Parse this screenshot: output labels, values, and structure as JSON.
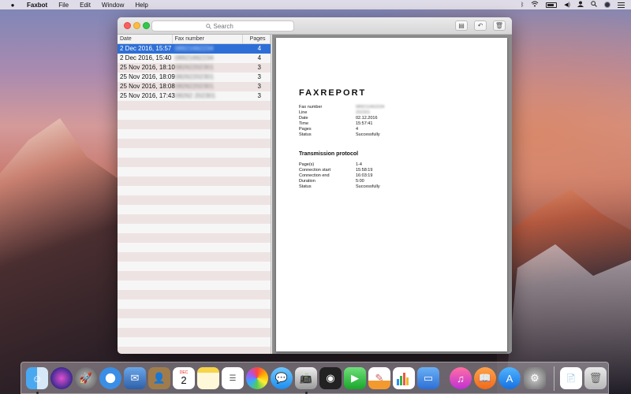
{
  "menubar": {
    "apple": "",
    "app": "Faxbot",
    "items": [
      "File",
      "Edit",
      "Window",
      "Help"
    ],
    "status": {
      "bluetooth": "ᛒ",
      "volume": "◀)",
      "battery_icon": "battery-icon",
      "list_icon": "list-icon",
      "user": "👤",
      "search": "🔍",
      "wifi": "wifi"
    }
  },
  "window": {
    "search_placeholder": "Search",
    "toolbar": {
      "doc": "▤",
      "reply": "↶",
      "trash": "🗑"
    },
    "table": {
      "headers": {
        "date": "Date",
        "fax": "Fax number",
        "pages": "Pages"
      },
      "rows": [
        {
          "date": "2 Dec 2016, 15:57",
          "fax": "08921662234",
          "pages": "4"
        },
        {
          "date": "2 Dec 2016, 15:40",
          "fax": "08921662234",
          "pages": "4"
        },
        {
          "date": "25 Nov 2016, 18:10",
          "fax": "08262202301",
          "pages": "3"
        },
        {
          "date": "25 Nov 2016, 18:09",
          "fax": "08262202301",
          "pages": "3"
        },
        {
          "date": "25 Nov 2016, 18:08",
          "fax": "08262202301",
          "pages": "3"
        },
        {
          "date": "25 Nov 2016, 17:43",
          "fax": "08262 202301",
          "pages": "3"
        }
      ]
    },
    "report": {
      "title": "FAXREPORT",
      "fields": [
        {
          "k": "Fax number",
          "v": "089211662234",
          "blur": true
        },
        {
          "k": "Line",
          "v": "202301",
          "blur": true
        },
        {
          "k": "Date",
          "v": "02.12.2016",
          "blur": false
        },
        {
          "k": "Time",
          "v": "15:57:41",
          "blur": false
        },
        {
          "k": "Pages",
          "v": "4",
          "blur": false
        },
        {
          "k": "Status",
          "v": "Successfully",
          "blur": false
        }
      ],
      "section": "Transmission protocol",
      "protocol": [
        {
          "k": "Page(s)",
          "v": "1-4"
        },
        {
          "k": "Connection start",
          "v": "15:58:19"
        },
        {
          "k": "Connection end",
          "v": "16:03:19"
        },
        {
          "k": "Duration",
          "v": "5:00"
        },
        {
          "k": "Status",
          "v": "Successfully"
        }
      ]
    }
  },
  "dock": {
    "calendar_month": "DEC",
    "calendar_day": "2",
    "icons": [
      "finder-icon",
      "siri-icon",
      "launchpad-icon",
      "safari-icon",
      "mail-photo-icon",
      "contacts-icon",
      "calendar-icon",
      "notes-icon",
      "reminders-icon",
      "photos-icon",
      "messages-icon",
      "faxbot-icon",
      "dvd-player-icon",
      "facetime-icon",
      "pages-icon",
      "numbers-icon",
      "keynote-icon",
      "itunes-icon",
      "ibooks-icon",
      "app-store-icon",
      "system-preferences-icon",
      "document-icon",
      "trash-icon"
    ]
  }
}
